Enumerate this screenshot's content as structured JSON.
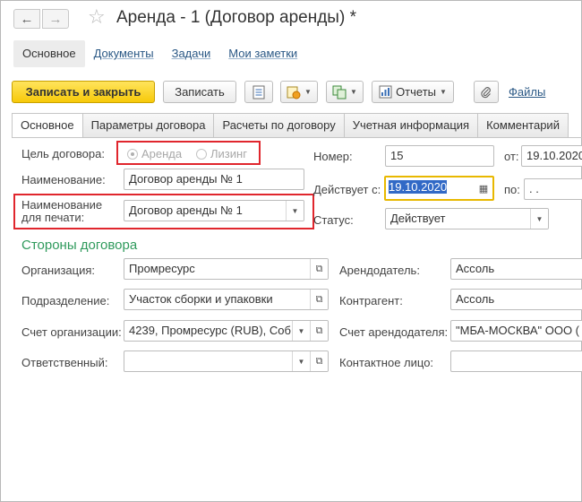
{
  "window": {
    "title": "Аренда - 1 (Договор аренды) *"
  },
  "nav": {
    "back_icon": "←",
    "forward_icon": "→",
    "star_icon": "☆"
  },
  "section_tabs": [
    "Основное",
    "Документы",
    "Задачи",
    "Мои заметки"
  ],
  "toolbar": {
    "write_close": "Записать и закрыть",
    "write": "Записать",
    "reports": "Отчеты",
    "files": "Файлы"
  },
  "form_tabs": [
    "Основное",
    "Параметры договора",
    "Расчеты по договору",
    "Учетная информация",
    "Комментарий"
  ],
  "form": {
    "purpose_label": "Цель договора:",
    "purpose_options": [
      "Аренда",
      "Лизинг"
    ],
    "purpose_selected": "Аренда",
    "name_label": "Наименование:",
    "name_value": "Договор аренды № 1",
    "print_name_label_1": "Наименование",
    "print_name_label_2": "для печати:",
    "print_name_value": "Договор аренды № 1",
    "number_label": "Номер:",
    "number_value": "15",
    "from_label": "от:",
    "from_value": "19.10.2020",
    "valid_from_label": "Действует с:",
    "valid_from_value": "19.10.2020",
    "to_label": "по:",
    "to_value": " .  .",
    "status_label": "Статус:",
    "status_value": "Действует"
  },
  "parties": {
    "title": "Стороны договора",
    "org_label": "Организация:",
    "org_value": "Промресурс",
    "dept_label": "Подразделение:",
    "dept_value": "Участок сборки и упаковки",
    "account_label": "Счет организации:",
    "account_value": "4239, Промресурс (RUB), Соб",
    "responsible_label": "Ответственный:",
    "responsible_value": "",
    "landlord_label": "Арендодатель:",
    "landlord_value": "Ассоль",
    "counterparty_label": "Контрагент:",
    "counterparty_value": "Ассоль",
    "landlord_account_label": "Счет арендодателя:",
    "landlord_account_value": "\"МБА-МОСКВА\" ООО (",
    "contact_label": "Контактное лицо:",
    "contact_value": ""
  },
  "colors": {
    "primary_button": "#f7c909",
    "highlight_red": "#e0262d",
    "section_green": "#2f9a5c",
    "link_blue": "#2a5885",
    "focus_yellow": "#e8b800"
  }
}
